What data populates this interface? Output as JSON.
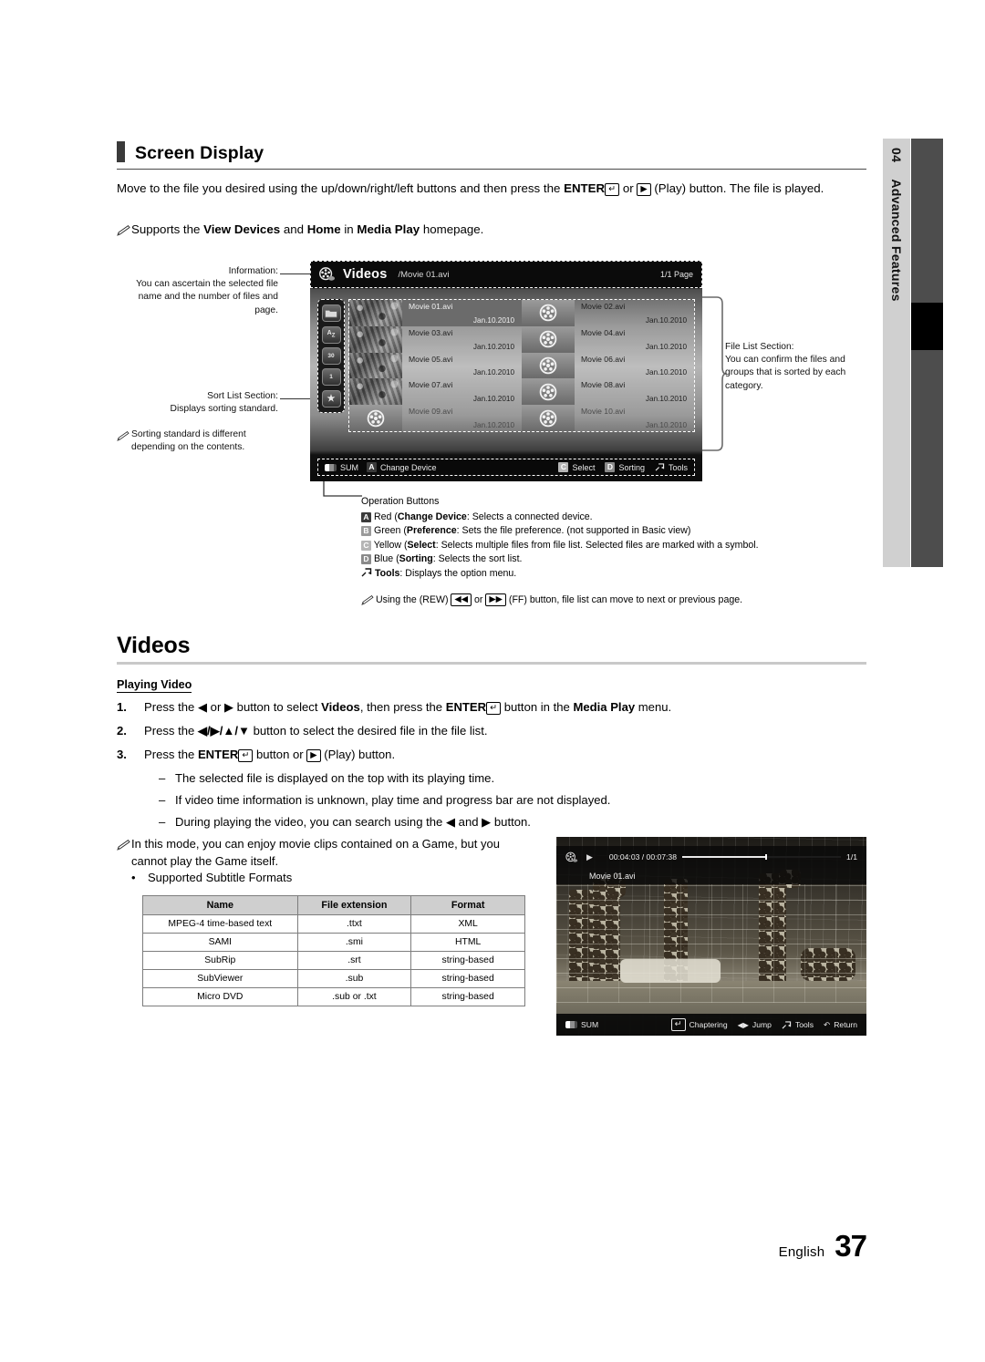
{
  "side_tab": {
    "number": "04",
    "label": "Advanced Features"
  },
  "section": {
    "heading": "Screen Display",
    "intro_before_enter": "Move to the file you desired using the up/down/right/left buttons and then press the ",
    "enter_label": "ENTER",
    "intro_mid": " or ",
    "intro_after_play": " (Play) button. The file is played.",
    "note_supports_pre": "Supports the ",
    "note_supports_b1": "View Devices",
    "note_supports_mid": " and ",
    "note_supports_b2": "Home",
    "note_supports_mid2": " in ",
    "note_supports_b3": "Media Play",
    "note_supports_end": " homepage."
  },
  "callouts": {
    "information_title": "Information:",
    "information_body": "You can ascertain the selected file name and the number of files and page.",
    "sort_title": "Sort List Section:",
    "sort_body": "Displays sorting standard.",
    "sort_note": "Sorting standard is different depending on the contents.",
    "filelist_title": "File List Section:",
    "filelist_body": "You can confirm the files and groups that is sorted by each category."
  },
  "tv": {
    "title": "Videos",
    "path": "/Movie 01.avi",
    "page": "1/1 Page",
    "sort_icons": [
      "folder-icon",
      "alphabet-sort-icon",
      "calendar-icon",
      "preference-icon",
      "star-icon"
    ],
    "sort_icon_labels": [
      "",
      "A Z",
      "30",
      "1",
      "★"
    ],
    "files": [
      {
        "name": "Movie 01.avi",
        "date": "Jan.10.2010",
        "thumb": "photo",
        "selected": true
      },
      {
        "name": "Movie 02.avi",
        "date": "Jan.10.2010",
        "thumb": "reel",
        "selected": false
      },
      {
        "name": "Movie 03.avi",
        "date": "Jan.10.2010",
        "thumb": "photo",
        "selected": false
      },
      {
        "name": "Movie 04.avi",
        "date": "Jan.10.2010",
        "thumb": "reel",
        "selected": false
      },
      {
        "name": "Movie 05.avi",
        "date": "Jan.10.2010",
        "thumb": "photo",
        "selected": false
      },
      {
        "name": "Movie 06.avi",
        "date": "Jan.10.2010",
        "thumb": "reel",
        "selected": false
      },
      {
        "name": "Movie 07.avi",
        "date": "Jan.10.2010",
        "thumb": "photo",
        "selected": false
      },
      {
        "name": "Movie 08.avi",
        "date": "Jan.10.2010",
        "thumb": "reel",
        "selected": false
      },
      {
        "name": "Movie 09.avi",
        "date": "Jan.10.2010",
        "thumb": "reel",
        "selected": false
      },
      {
        "name": "Movie 10.avi",
        "date": "Jan.10.2010",
        "thumb": "reel",
        "selected": false
      }
    ],
    "footer_left": [
      {
        "key": "sum-icon",
        "label": "SUM"
      },
      {
        "key": "A",
        "label": "Change Device"
      }
    ],
    "footer_right": [
      {
        "key": "C",
        "label": "Select"
      },
      {
        "key": "D",
        "label": "Sorting"
      },
      {
        "key": "tools-icon",
        "label": "Tools"
      }
    ]
  },
  "operation_buttons": {
    "title": "Operation Buttons",
    "rows": [
      {
        "key": "A",
        "key_style": "dark",
        "color": "Red",
        "name": "Change Device",
        "desc": ": Selects a connected device."
      },
      {
        "key": "B",
        "key_style": "gray",
        "color": "Green",
        "name": "Preference",
        "desc": ": Sets the file preference. (not supported in Basic view)"
      },
      {
        "key": "C",
        "key_style": "gray2",
        "color": "Yellow",
        "name": "Select",
        "desc": ": Selects multiple files from file list. Selected files are marked with a symbol."
      },
      {
        "key": "D",
        "key_style": "gray3",
        "color": "Blue",
        "name": "Sorting",
        "desc": ": Selects the sort list."
      }
    ],
    "tools_label": "Tools",
    "tools_desc": ": Displays the option menu.",
    "note_pre": "Using the (REW) ",
    "note_mid": " or ",
    "note_post": " (FF) button, file list can move to next or previous page."
  },
  "videos": {
    "heading": "Videos",
    "subheading": "Playing Video",
    "steps": [
      {
        "n": "1.",
        "parts": [
          "Press the ",
          "◀",
          " or ",
          "▶",
          " button to select ",
          "Videos",
          ", then press the ",
          "ENTER",
          " button in the ",
          "Media Play",
          " menu."
        ]
      },
      {
        "n": "2.",
        "text_pre": "Press the ",
        "arrows": "◀/▶/▲/▼",
        "text_post": " button to select the desired file in the file list."
      },
      {
        "n": "3.",
        "text_pre": "Press the ",
        "enter": "ENTER",
        "text_mid": " button or ",
        "text_post": " (Play) button."
      }
    ],
    "dashes": [
      "The selected file is displayed on the top with its playing time.",
      "If video time information is unknown, play time and progress bar are not displayed.",
      "During playing the video, you can search using the ◀ and ▶ button."
    ],
    "game_note": "In this mode, you can enjoy movie clips contained on a Game, but you cannot play the Game itself.",
    "subtitle_bullet": "Supported Subtitle Formats",
    "subtitle_table": {
      "headers": [
        "Name",
        "File extension",
        "Format"
      ],
      "rows": [
        [
          "MPEG-4 time-based text",
          ".ttxt",
          "XML"
        ],
        [
          "SAMI",
          ".smi",
          "HTML"
        ],
        [
          "SubRip",
          ".srt",
          "string-based"
        ],
        [
          "SubViewer",
          ".sub",
          "string-based"
        ],
        [
          "Micro DVD",
          ".sub or .txt",
          "string-based"
        ]
      ]
    }
  },
  "player": {
    "time": "00:04:03 / 00:07:38",
    "index": "1/1",
    "filename": "Movie 01.avi",
    "footer_left": [
      {
        "key": "sum-icon",
        "label": "SUM"
      }
    ],
    "footer_right": [
      {
        "key": "enter-icon",
        "label": "Chaptering"
      },
      {
        "key": "leftright-icon",
        "label": "Jump"
      },
      {
        "key": "tools-icon",
        "label": "Tools"
      },
      {
        "key": "return-icon",
        "label": "Return"
      }
    ]
  },
  "footer": {
    "language": "English",
    "page": "37"
  }
}
